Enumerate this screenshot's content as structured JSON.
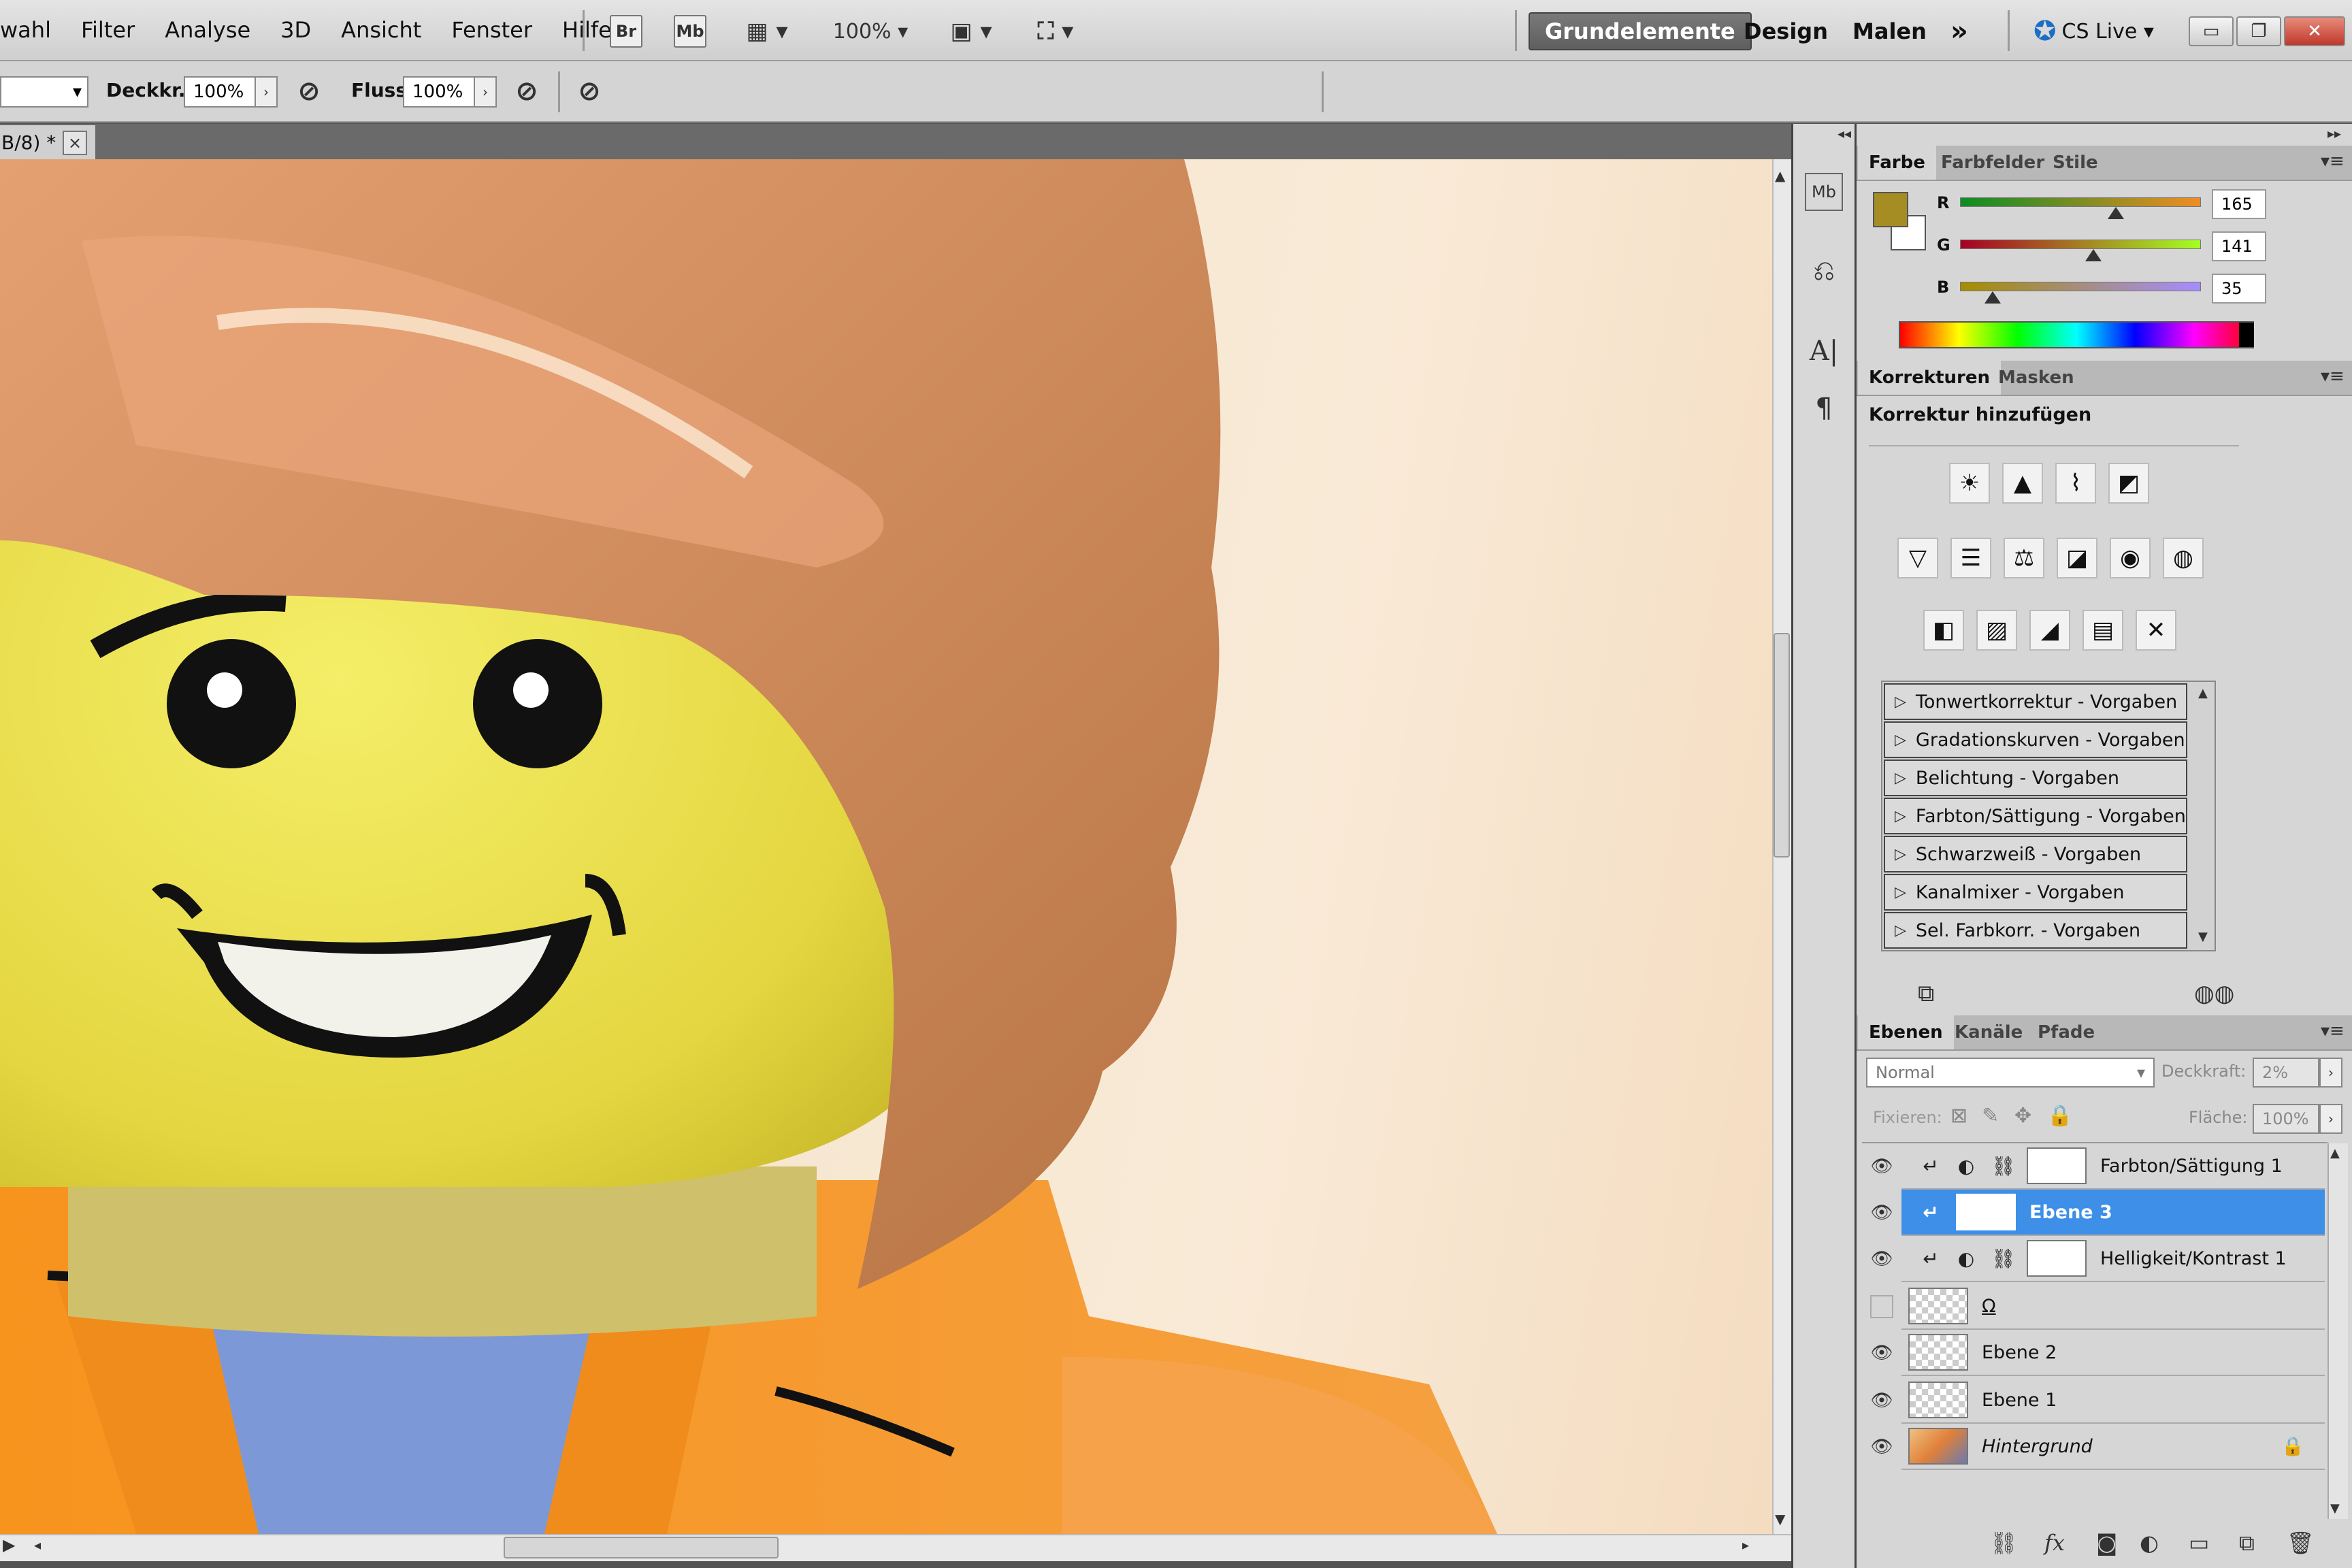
{
  "menubar": {
    "items": [
      "wahl",
      "Filter",
      "Analyse",
      "3D",
      "Ansicht",
      "Fenster",
      "Hilfe"
    ],
    "zoom": "100%",
    "btn_br": "Br",
    "btn_mb": "Mb"
  },
  "workspaces": {
    "active": "Grundelemente",
    "design": "Design",
    "malen": "Malen",
    "more": "»",
    "cslive": "CS Live"
  },
  "window": {
    "minimize": "▭",
    "restore": "❐",
    "close": "✕"
  },
  "options": {
    "opacity_label": "Deckkr.:",
    "opacity_value": "100%",
    "flow_label": "Fluss:",
    "flow_value": "100%"
  },
  "document": {
    "tab_label": "B/8) *",
    "tab_close": "×"
  },
  "color_panel": {
    "tabs": [
      "Farbe",
      "Farbfelder",
      "Stile"
    ],
    "foreground": "#a58d23",
    "r_label": "R",
    "g_label": "G",
    "b_label": "B",
    "r": "165",
    "g": "141",
    "b": "35",
    "r_fraction": 0.647,
    "g_fraction": 0.553,
    "b_fraction": 0.137
  },
  "adjustments": {
    "tabs": [
      "Korrekturen",
      "Masken"
    ],
    "title": "Korrektur hinzufügen",
    "icons_row1": [
      "brightness-icon",
      "levels-icon",
      "curves-icon",
      "exposure-icon"
    ],
    "icons_row2": [
      "vibrance-icon",
      "hue-saturation-icon",
      "color-balance-icon",
      "black-white-icon",
      "photo-filter-icon",
      "channel-mixer-icon"
    ],
    "icons_row3": [
      "invert-icon",
      "posterize-icon",
      "threshold-icon",
      "gradient-map-icon",
      "selective-color-icon"
    ],
    "presets": [
      "Tonwertkorrektur - Vorgaben",
      "Gradationskurven - Vorgaben",
      "Belichtung - Vorgaben",
      "Farbton/Sättigung - Vorgaben",
      "Schwarzweiß - Vorgaben",
      "Kanalmixer - Vorgaben",
      "Sel. Farbkorr. - Vorgaben"
    ]
  },
  "layers_panel": {
    "tabs": [
      "Ebenen",
      "Kanäle",
      "Pfade"
    ],
    "blend_mode": "Normal",
    "opacity_label": "Deckkraft:",
    "opacity_value": "2%",
    "lock_label": "Fixieren:",
    "fill_label": "Fläche:",
    "fill_value": "100%",
    "layers": [
      {
        "name": "Farbton/Sättigung 1",
        "visible": true
      },
      {
        "name": "Ebene 3",
        "visible": true,
        "selected": true
      },
      {
        "name": "Helligkeit/Kontrast 1",
        "visible": true
      },
      {
        "name": "Ω",
        "visible": false
      },
      {
        "name": "Ebene 2",
        "visible": true
      },
      {
        "name": "Ebene 1",
        "visible": true
      },
      {
        "name": "Hintergrund",
        "visible": true,
        "locked": true
      }
    ]
  }
}
